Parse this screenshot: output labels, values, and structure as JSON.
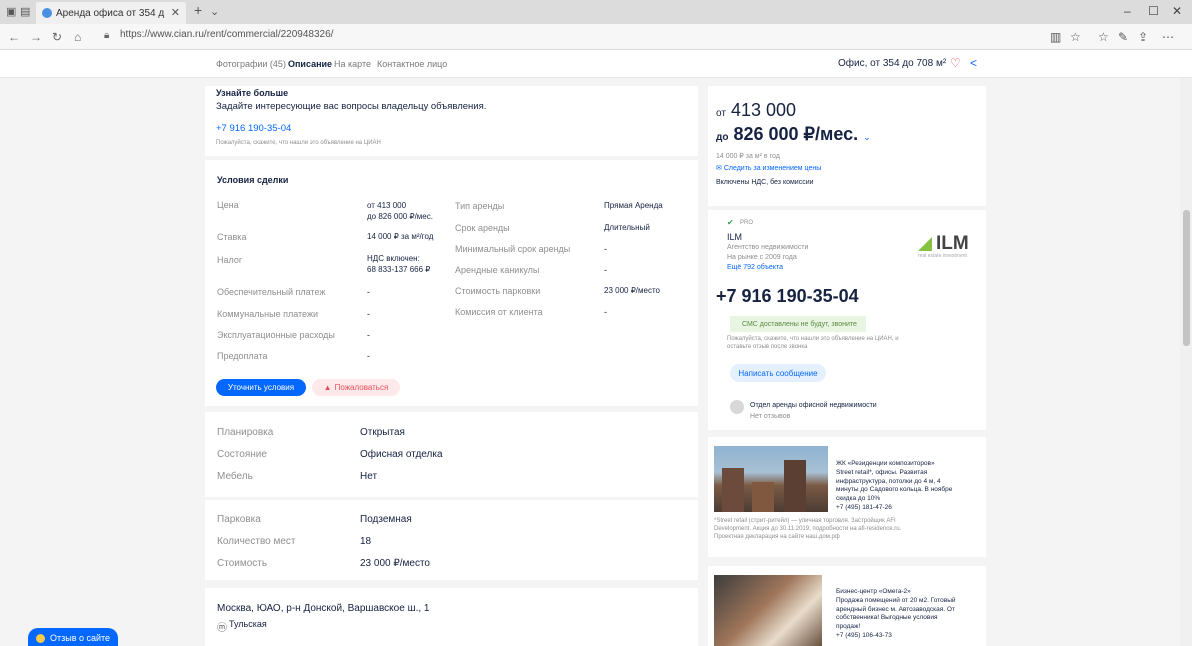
{
  "browser": {
    "tab_title": "Аренда офиса от 354 д",
    "url": "https://www.cian.ru/rent/commercial/220948326/"
  },
  "header": {
    "tabs": [
      {
        "label": "Фотографии (45)"
      },
      {
        "label": "Описание"
      },
      {
        "label": "На карте"
      },
      {
        "label": "Контактное лицо"
      }
    ],
    "summary": "Офис, от 354 до 708 м²"
  },
  "learn_more": {
    "title": "Узнайте больше",
    "subtitle": "Задайте интересующие вас вопросы владельцу объявления.",
    "phone": "+7 916 190-35-04",
    "note": "Пожалуйста, скажите, что нашли это объявление на ЦИАН"
  },
  "deal": {
    "title": "Условия сделки",
    "left_rows": [
      {
        "label": "Цена",
        "value": "от 413 000\nдо 826 000 ₽/мес."
      },
      {
        "label": "Ставка",
        "value": "14 000 ₽ за м²/год"
      },
      {
        "label": "Налог",
        "value": "НДС включен:\n68 833-137 666 ₽"
      },
      {
        "label": "Обеспечительный платеж",
        "value": "-"
      },
      {
        "label": "Коммунальные платежи",
        "value": "-"
      },
      {
        "label": "Эксплуатационные расходы",
        "value": "-"
      },
      {
        "label": "Предоплата",
        "value": "-"
      }
    ],
    "right_rows": [
      {
        "label": "Тип аренды",
        "value": "Прямая Аренда"
      },
      {
        "label": "Срок аренды",
        "value": "Длительный"
      },
      {
        "label": "Минимальный срок аренды",
        "value": "-"
      },
      {
        "label": "Арендные каникулы",
        "value": "-"
      },
      {
        "label": "Стоимость парковки",
        "value": "23 000 ₽/место"
      },
      {
        "label": "Комиссия от клиента",
        "value": "-"
      }
    ],
    "btn_clarify": "Уточнить условия",
    "btn_complain": "Пожаловаться"
  },
  "features": [
    {
      "label": "Планировка",
      "value": "Открытая"
    },
    {
      "label": "Состояние",
      "value": "Офисная отделка"
    },
    {
      "label": "Мебель",
      "value": "Нет"
    }
  ],
  "parking": [
    {
      "label": "Парковка",
      "value": "Подземная"
    },
    {
      "label": "Количество мест",
      "value": "18"
    },
    {
      "label": "Стоимость",
      "value": "23 000 ₽/место"
    }
  ],
  "address": {
    "line": "Москва, ЮАО, р-н Донской, Варшавское ш., 1",
    "metro": "Тульская"
  },
  "feedback_btn": "Отзыв о сайте",
  "sidebar": {
    "price_from": "413 000",
    "price_to": "826 000 ₽/мес.",
    "from_prefix": "от",
    "to_prefix": "до",
    "rate": "14 000 ₽ за м² в год",
    "follow": "Следить за изменением цены",
    "vat": "Включены НДС, без комиссии",
    "agency_badge": "PRO",
    "agency_name": "ILM",
    "agency_type": "Агентство недвижимости",
    "agency_since": "На рынке с 2009 года",
    "agency_more": "Ещё 792 объекта",
    "logo_text": "ILM",
    "logo_sub": "real estate investment",
    "phone": "+7 916 190-35-04",
    "sms": "СМС доставлены не будут, звоните",
    "phone_note": "Пожалуйста, скажите, что нашли это объявление на ЦИАН, и оставьте отзыв после звонка",
    "btn_message": "Написать сообщение",
    "dept_name": "Отдел аренды офисной недвижимости",
    "dept_reviews": "Нет отзывов"
  },
  "ads": [
    {
      "text": "ЖК «Резиденции композиторов»\nStreet retail*, офисы. Развитая\nинфраструктура, потолки до 4 м, 4\nминуты до Садового кольца. В ноябре\nскидка до 10%\n+7 (495) 181-47-26",
      "small": "*Street retail (стрит-ритейл) — уличная торговля. Застройщик AFI\nDevelopment. Акция до 30.11.2019, подробности на afi-residence.ru.\nПроектная декларация на сайте наш.дом.рф"
    },
    {
      "text": "Бизнес-центр «Омега-2»\nПродажа помещений от 20 м2. Готовый\nарендный бизнес м. Автозаводская. От\nсобственника! Выгодные условия\nпродаж!\n+7 (495) 106-43-73",
      "small": ""
    }
  ]
}
